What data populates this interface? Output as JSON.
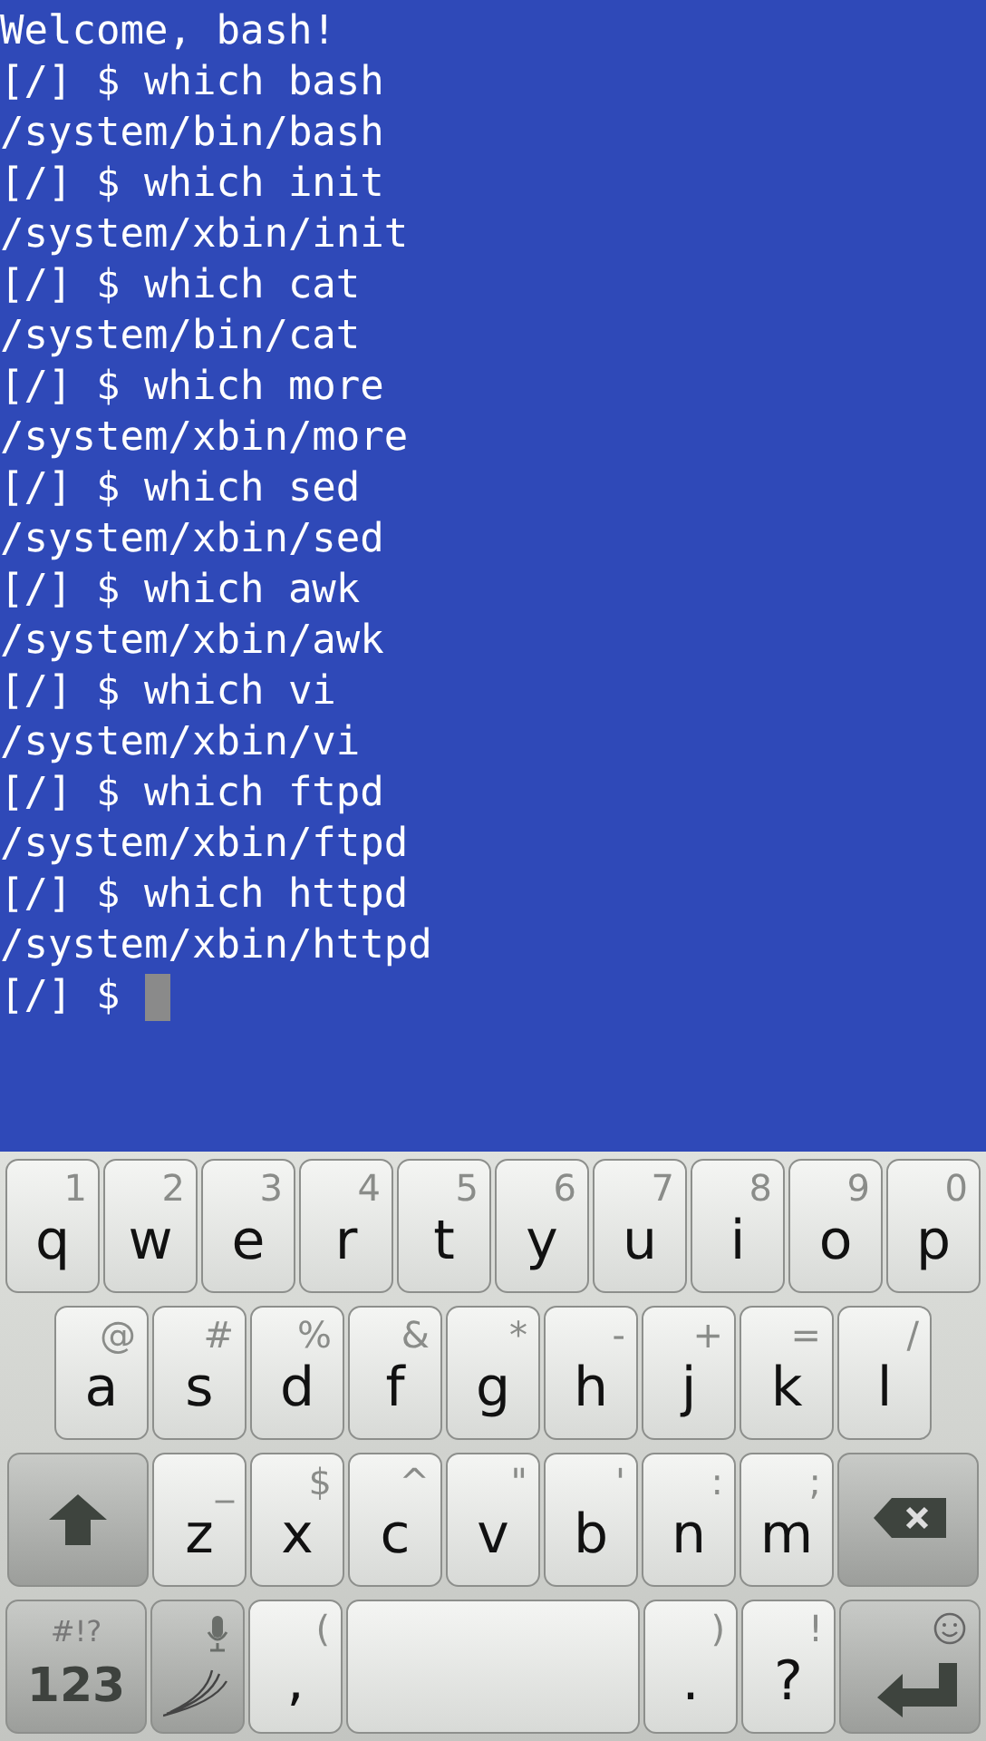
{
  "terminal": {
    "lines": [
      "Welcome, bash!",
      "[/] $ which bash",
      "/system/bin/bash",
      "[/] $ which init",
      "/system/xbin/init",
      "[/] $ which cat",
      "/system/bin/cat",
      "[/] $ which more",
      "/system/xbin/more",
      "[/] $ which sed",
      "/system/xbin/sed",
      "[/] $ which awk",
      "/system/xbin/awk",
      "[/] $ which vi",
      "/system/xbin/vi",
      "[/] $ which ftpd",
      "/system/xbin/ftpd",
      "[/] $ which httpd",
      "/system/xbin/httpd"
    ],
    "prompt": "[/] $",
    "cursor": true
  },
  "keyboard": {
    "rows": [
      {
        "keys": [
          {
            "kind": "letter",
            "label": "q",
            "hint": "1"
          },
          {
            "kind": "letter",
            "label": "w",
            "hint": "2"
          },
          {
            "kind": "letter",
            "label": "e",
            "hint": "3"
          },
          {
            "kind": "letter",
            "label": "r",
            "hint": "4"
          },
          {
            "kind": "letter",
            "label": "t",
            "hint": "5"
          },
          {
            "kind": "letter",
            "label": "y",
            "hint": "6"
          },
          {
            "kind": "letter",
            "label": "u",
            "hint": "7"
          },
          {
            "kind": "letter",
            "label": "i",
            "hint": "8"
          },
          {
            "kind": "letter",
            "label": "o",
            "hint": "9"
          },
          {
            "kind": "letter",
            "label": "p",
            "hint": "0"
          }
        ]
      },
      {
        "keys": [
          {
            "kind": "letter",
            "label": "a",
            "hint": "@"
          },
          {
            "kind": "letter",
            "label": "s",
            "hint": "#"
          },
          {
            "kind": "letter",
            "label": "d",
            "hint": "%"
          },
          {
            "kind": "letter",
            "label": "f",
            "hint": "&"
          },
          {
            "kind": "letter",
            "label": "g",
            "hint": "*"
          },
          {
            "kind": "letter",
            "label": "h",
            "hint": "-"
          },
          {
            "kind": "letter",
            "label": "j",
            "hint": "+"
          },
          {
            "kind": "letter",
            "label": "k",
            "hint": "="
          },
          {
            "kind": "letter",
            "label": "l",
            "hint": "/"
          }
        ]
      },
      {
        "keys": [
          {
            "kind": "shift"
          },
          {
            "kind": "letter",
            "label": "z",
            "hint": "_"
          },
          {
            "kind": "letter",
            "label": "x",
            "hint": "$"
          },
          {
            "kind": "letter",
            "label": "c",
            "hint": "^"
          },
          {
            "kind": "letter",
            "label": "v",
            "hint": "\""
          },
          {
            "kind": "letter",
            "label": "b",
            "hint": "'"
          },
          {
            "kind": "letter",
            "label": "n",
            "hint": ":"
          },
          {
            "kind": "letter",
            "label": "m",
            "hint": ";"
          },
          {
            "kind": "backspace"
          }
        ]
      },
      {
        "keys": [
          {
            "kind": "symbols",
            "label": "123",
            "hint": "#!?"
          },
          {
            "kind": "swype"
          },
          {
            "kind": "letter",
            "label": ",",
            "hint": "("
          },
          {
            "kind": "space"
          },
          {
            "kind": "letter",
            "label": ".",
            "hint": ")"
          },
          {
            "kind": "letter",
            "label": "?",
            "hint": "!"
          },
          {
            "kind": "enter"
          }
        ]
      }
    ]
  }
}
